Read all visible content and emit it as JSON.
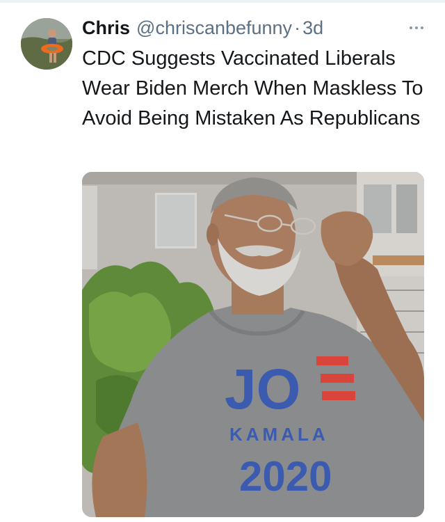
{
  "tweet": {
    "author_name": "Chris",
    "handle": "@chriscanbefunny",
    "separator": "·",
    "timestamp": "3d",
    "text": "CDC Suggests Vaccinated Liberals Wear Biden Merch When Maskless To Avoid Being Mistaken As Republicans",
    "more_icon": "more-horizontal-icon"
  },
  "media": {
    "shirt_line1": "JO",
    "shirt_line2": "KAMALA",
    "shirt_line3": "2020",
    "colors": {
      "shirt": "#8a8b8d",
      "text_blue": "#3b5bb0",
      "stripe_red": "#d9453b"
    }
  }
}
